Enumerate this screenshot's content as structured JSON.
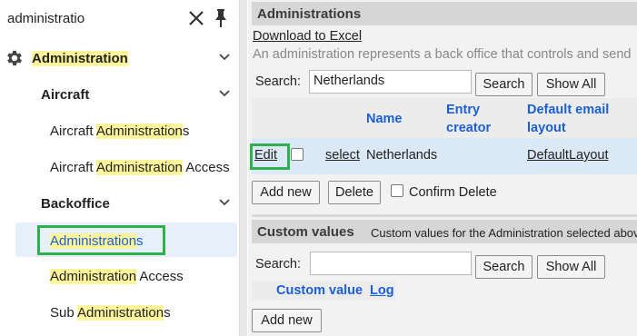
{
  "sidebar": {
    "search_value": "administratio",
    "items": [
      {
        "pre": "",
        "hl": "Administration",
        "post": ""
      },
      {
        "label": "Aircraft"
      },
      {
        "pre": "Aircraft ",
        "hl": "Administration",
        "post": "s"
      },
      {
        "pre": "Aircraft ",
        "hl": "Administration",
        "post": " Access"
      },
      {
        "label": "Backoffice"
      },
      {
        "pre": "",
        "hl": "Administration",
        "post": "s"
      },
      {
        "pre": "",
        "hl": "Administration",
        "post": " Access"
      },
      {
        "pre": "Sub ",
        "hl": "Administration",
        "post": "s"
      }
    ]
  },
  "administrations": {
    "title": "Administrations",
    "download_link": "Download to Excel",
    "description": "An administration represents a back office that controls and send",
    "search_label": "Search:",
    "search_value": "Netherlands",
    "search_button": "Search",
    "show_all_button": "Show All",
    "columns": [
      "Name",
      "Entry creator",
      "Default email layout"
    ],
    "row": {
      "edit": "Edit",
      "select": "select",
      "name": "Netherlands",
      "layout": "DefaultLayout"
    },
    "add_new_button": "Add new",
    "delete_button": "Delete",
    "confirm_delete_label": "Confirm Delete"
  },
  "custom_values": {
    "title": "Custom values",
    "subtitle": "Custom values for the Administration selected above",
    "search_label": "Search:",
    "search_value": "",
    "search_button": "Search",
    "show_all_button": "Show All",
    "col_custom_value": "Custom value",
    "col_log": "Log",
    "add_new_button": "Add new"
  },
  "colors": {
    "accent": "#1a5fd6",
    "highlight": "#fff59a",
    "selection_outline": "#2fb04a",
    "selected_bg": "#e6f0fb"
  }
}
